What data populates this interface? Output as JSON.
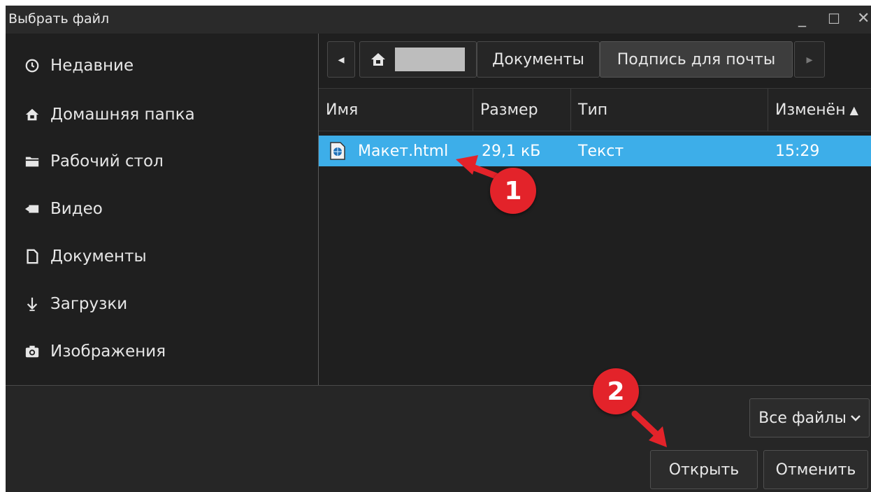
{
  "window": {
    "title": "Выбрать файл",
    "minimize_glyph": "_",
    "maximize_glyph": "☐",
    "close_glyph": "✕"
  },
  "sidebar": {
    "items": [
      {
        "label": "Недавние",
        "icon": "clock-icon"
      },
      {
        "label": "Домашняя папка",
        "icon": "home-icon"
      },
      {
        "label": "Рабочий стол",
        "icon": "folder-icon"
      },
      {
        "label": "Видео",
        "icon": "video-icon"
      },
      {
        "label": "Документы",
        "icon": "document-icon"
      },
      {
        "label": "Загрузки",
        "icon": "download-icon"
      },
      {
        "label": "Изображения",
        "icon": "camera-icon"
      }
    ]
  },
  "pathbar": {
    "back_glyph": "◂",
    "forward_glyph": "▸",
    "segments": [
      "Документы",
      "Подпись для почты"
    ]
  },
  "file_list": {
    "columns": [
      "Имя",
      "Размер",
      "Тип",
      "Изменён"
    ],
    "sort_indicator": "▲",
    "rows": [
      {
        "name": "Макет.html",
        "size": "29,1 кБ",
        "type": "Текст",
        "modified": "15:29"
      }
    ]
  },
  "footer": {
    "filter_label": "Все файлы",
    "filter_chevron": "⌄",
    "open_label": "Открыть",
    "cancel_label": "Отменить"
  },
  "annotations": {
    "step1": "1",
    "step2": "2",
    "color": "#e3232a"
  },
  "colors": {
    "selection": "#3daee9",
    "background": "#1f1f1f"
  }
}
